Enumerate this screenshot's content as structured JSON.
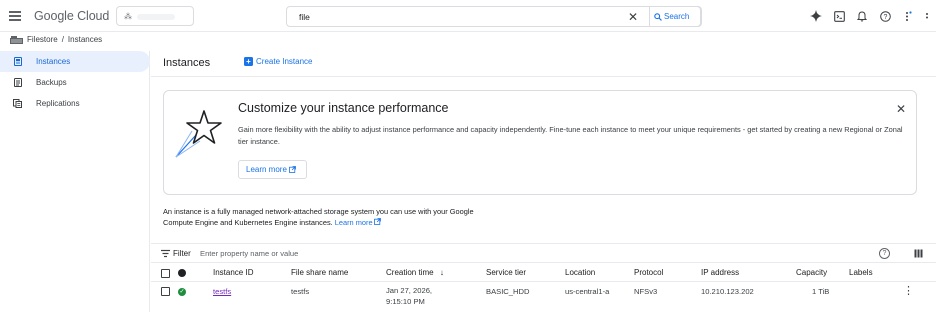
{
  "header": {
    "logo_google": "Google",
    "logo_cloud": "Cloud",
    "search_value": "file",
    "search_button": "Search"
  },
  "breadcrumb": {
    "product": "Filestore",
    "separator": "/",
    "page": "Instances"
  },
  "sidebar": {
    "items": [
      {
        "label": "Instances",
        "icon": "instances-icon",
        "active": true
      },
      {
        "label": "Backups",
        "icon": "backups-icon",
        "active": false
      },
      {
        "label": "Replications",
        "icon": "replications-icon",
        "active": false
      }
    ]
  },
  "main": {
    "title": "Instances",
    "create_label": "Create Instance",
    "promo": {
      "title": "Customize your instance performance",
      "description": "Gain more flexibility with the ability to adjust instance performance and capacity independently. Fine-tune each instance to meet your unique requirements - get started by creating a new Regional or Zonal tier instance.",
      "learn_more": "Learn more"
    },
    "intro_text": "An instance is a fully managed network-attached storage system you can use with your Google Compute Engine and Kubernetes Engine instances.",
    "intro_link": "Learn more",
    "filter_label": "Filter",
    "filter_placeholder": "Enter property name or value"
  },
  "table": {
    "columns": [
      "Instance ID",
      "File share name",
      "Creation time",
      "Service tier",
      "Location",
      "Protocol",
      "IP address",
      "Capacity",
      "Labels"
    ],
    "sort_arrow": "↓",
    "rows": [
      {
        "status": "ok",
        "instance_id": "testfs",
        "file_share": "testfs",
        "creation_line1": "Jan 27, 2026,",
        "creation_line2": "9:15:10 PM",
        "service_tier": "BASIC_HDD",
        "location": "us-central1-a",
        "protocol": "NFSv3",
        "ip_address": "10.210.123.202",
        "capacity": "1 TiB",
        "labels": ""
      }
    ]
  },
  "colors": {
    "accent": "#1a73e8",
    "active_bg": "#e8f0fe",
    "status_ok": "#1e8e3e",
    "visited_link": "#7627bb"
  }
}
